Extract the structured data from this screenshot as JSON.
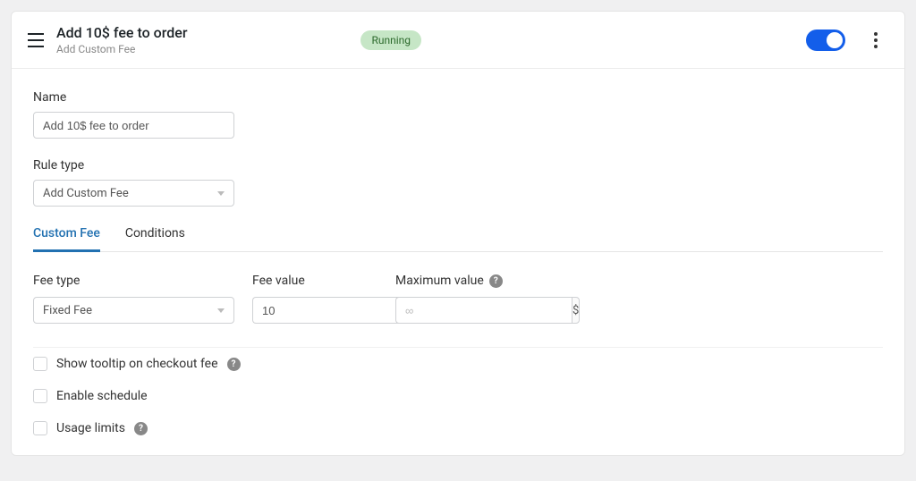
{
  "header": {
    "title": "Add 10$ fee to order",
    "subtitle": "Add Custom Fee",
    "status": "Running"
  },
  "form": {
    "name_label": "Name",
    "name_value": "Add 10$ fee to order",
    "rule_type_label": "Rule type",
    "rule_type_value": "Add Custom Fee"
  },
  "tabs": {
    "custom_fee": "Custom Fee",
    "conditions": "Conditions"
  },
  "fee": {
    "fee_type_label": "Fee type",
    "fee_type_value": "Fixed Fee",
    "fee_value_label": "Fee value",
    "fee_value": "10",
    "fee_value_unit": "$",
    "max_value_label": "Maximum value",
    "max_value_placeholder": "∞",
    "max_value_unit": "$"
  },
  "options": {
    "tooltip": "Show tooltip on checkout fee",
    "schedule": "Enable schedule",
    "usage": "Usage limits"
  },
  "help_glyph": "?"
}
